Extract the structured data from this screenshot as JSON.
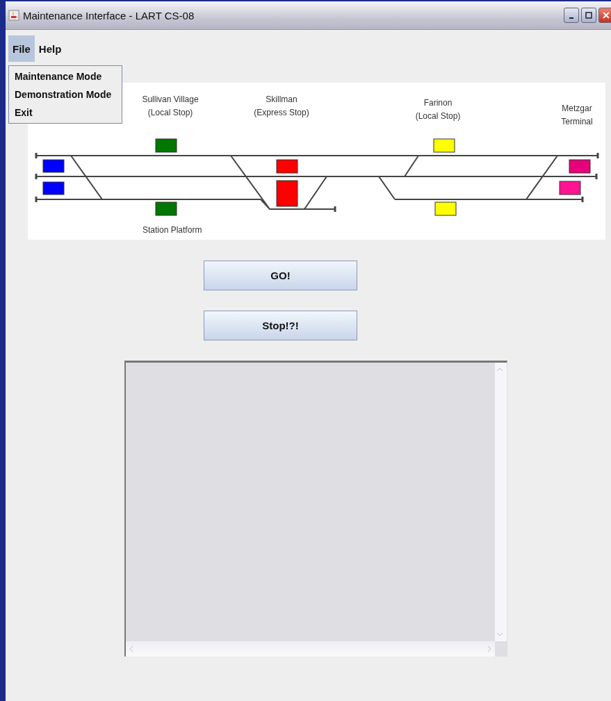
{
  "window": {
    "title": "Maintenance Interface - LART CS-08"
  },
  "menu_bar": [
    {
      "label": "File",
      "selected": true
    },
    {
      "label": "Help",
      "selected": false
    }
  ],
  "open_menu": {
    "items": [
      "Maintenance Mode",
      "Demonstration Mode",
      "Exit"
    ]
  },
  "track_map": {
    "stations": [
      {
        "name": "Sullivan Village",
        "note": "(Local Stop)"
      },
      {
        "name": "Skillman",
        "note": "(Express Stop)"
      },
      {
        "name": "Farinon",
        "note": "(Local Stop)"
      },
      {
        "name": "Metzgar",
        "note": "Terminal"
      }
    ],
    "platform_label": "Station Platform",
    "signals": [
      {
        "color": "#0000ff"
      },
      {
        "color": "#0000ff"
      },
      {
        "color": "#007700"
      },
      {
        "color": "#007700"
      },
      {
        "color": "#ff0000"
      },
      {
        "color": "#ff0000"
      },
      {
        "color": "#ffff00"
      },
      {
        "color": "#ffff00"
      },
      {
        "color": "#e8007a"
      },
      {
        "color": "#ff1493"
      }
    ]
  },
  "buttons": [
    "GO!",
    "Stop!?!"
  ]
}
